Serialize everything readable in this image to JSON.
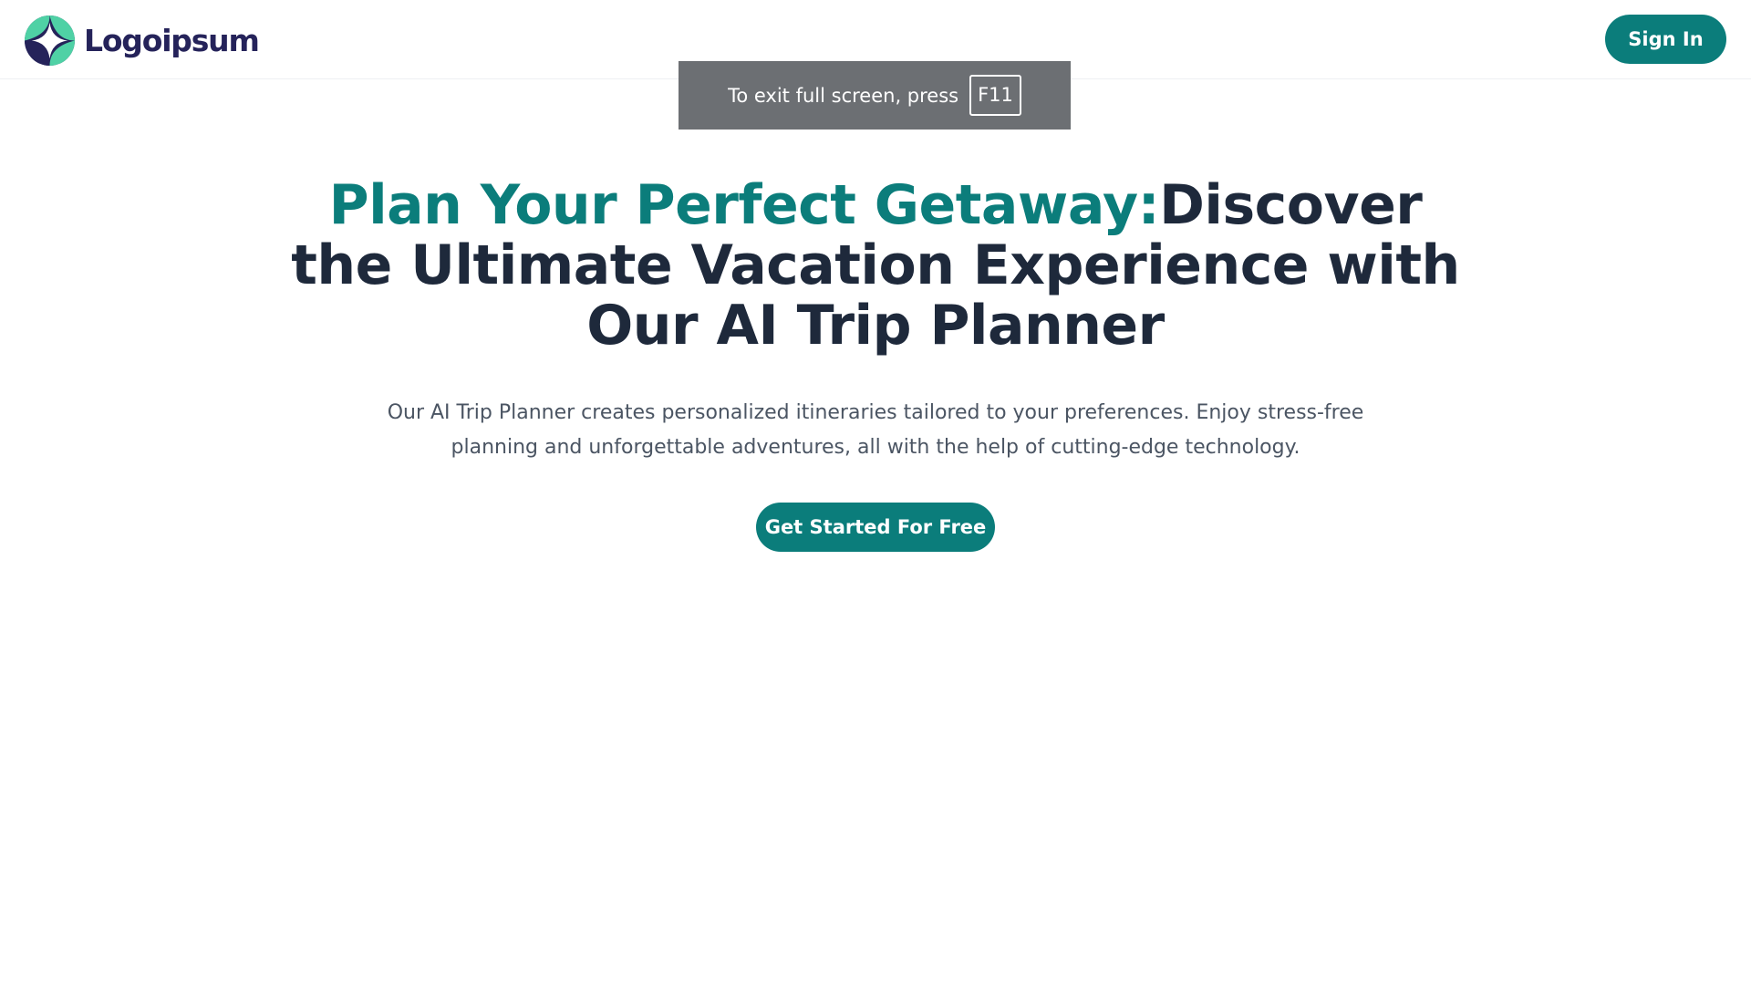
{
  "header": {
    "logo_text": "Logoipsum",
    "signin_label": "Sign In"
  },
  "fullscreen_notice": {
    "text": "To exit full screen, press",
    "key": "F11"
  },
  "hero": {
    "title_accent": "Plan Your Perfect Getaway:",
    "title_rest": "Discover the Ultimate Vacation Experience with Our AI Trip Planner",
    "subtitle": "Our AI Trip Planner creates personalized itineraries tailored to your preferences. Enjoy stress-free planning and unforgettable adventures, all with the help of cutting-edge technology.",
    "cta_label": "Get Started For Free"
  },
  "colors": {
    "brand": "#0b7d7b",
    "logo_navy": "#25235a",
    "logo_mint": "#4fd1a5",
    "heading": "#1e293b",
    "body_text": "#4b5563",
    "toast_bg": "#6c6f73"
  },
  "icons": {
    "logo": "four-point-star-logo-icon"
  }
}
